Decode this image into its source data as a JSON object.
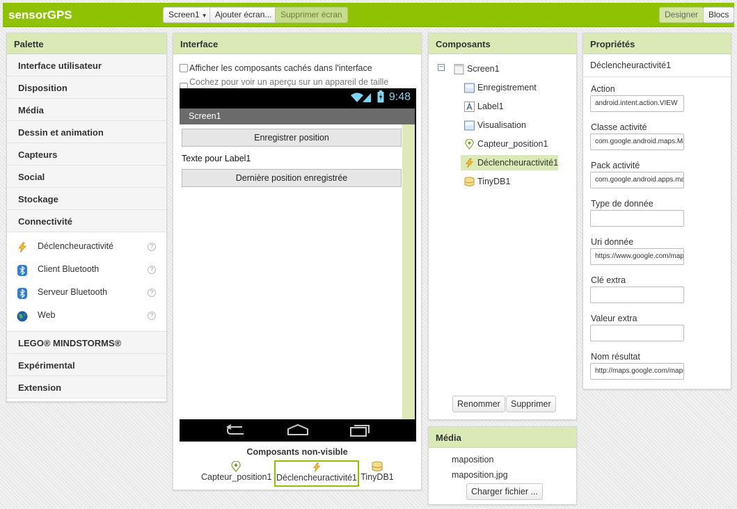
{
  "app": {
    "title": "sensorGPS"
  },
  "toolbar": {
    "screen_select": "Screen1",
    "add_screen": "Ajouter écran...",
    "remove_screen": "Supprimer écran",
    "designer": "Designer",
    "blocks": "Blocs"
  },
  "palette": {
    "title": "Palette",
    "categories_top": [
      "Interface utilisateur",
      "Disposition",
      "Média",
      "Dessin et animation",
      "Capteurs",
      "Social",
      "Stockage",
      "Connectivité"
    ],
    "connectivity_items": [
      {
        "label": "Déclencheuractivité",
        "icon": "lightning-icon"
      },
      {
        "label": "Client Bluetooth",
        "icon": "bluetooth-icon"
      },
      {
        "label": "Serveur Bluetooth",
        "icon": "bluetooth-icon"
      },
      {
        "label": "Web",
        "icon": "globe-icon"
      }
    ],
    "help_glyph": "?",
    "categories_bottom": [
      "LEGO® MINDSTORMS®",
      "Expérimental",
      "Extension"
    ]
  },
  "interface": {
    "title": "Interface",
    "show_hidden": "Afficher les composants cachés dans l'interface",
    "tablet_preview": "Cochez pour voir un aperçu sur un appareil de taille tablette.",
    "clock": "9:48",
    "screen_title": "Screen1",
    "button1": "Enregistrer position",
    "label1": "Texte pour Label1",
    "button2": "Dernière position enregistrée",
    "nonvisible_title": "Composants non-visible",
    "nonvisible": [
      "Capteur_position1",
      "Déclencheuractivité1",
      "TinyDB1"
    ]
  },
  "components": {
    "title": "Composants",
    "root": "Screen1",
    "children": [
      "Enregistrement",
      "Label1",
      "Visualisation",
      "Capteur_position1",
      "Déclencheuractivité1",
      "TinyDB1"
    ],
    "selected": "Déclencheuractivité1",
    "rename": "Renommer",
    "delete": "Supprimer"
  },
  "media": {
    "title": "Média",
    "files": [
      "maposition",
      "maposition.jpg"
    ],
    "upload": "Charger fichier ..."
  },
  "properties": {
    "title": "Propriétés",
    "component": "Déclencheuractivité1",
    "fields": [
      {
        "label": "Action",
        "value": "android.intent.action.VIEW"
      },
      {
        "label": "Classe activité",
        "value": "com.google.android.maps.MapsActivity"
      },
      {
        "label": "Pack activité",
        "value": "com.google.android.apps.maps"
      },
      {
        "label": "Type de donnée",
        "value": ""
      },
      {
        "label": "Uri donnée",
        "value": "https://www.google.com/maps"
      },
      {
        "label": "Clé extra",
        "value": ""
      },
      {
        "label": "Valeur extra",
        "value": ""
      },
      {
        "label": "Nom résultat",
        "value": "http://maps.google.com/maps"
      }
    ]
  },
  "colors": {
    "brand": "#8fc202",
    "panel_head": "#dbe9b6",
    "selected": "#dbe9b6",
    "clock": "#7fd6f0"
  }
}
